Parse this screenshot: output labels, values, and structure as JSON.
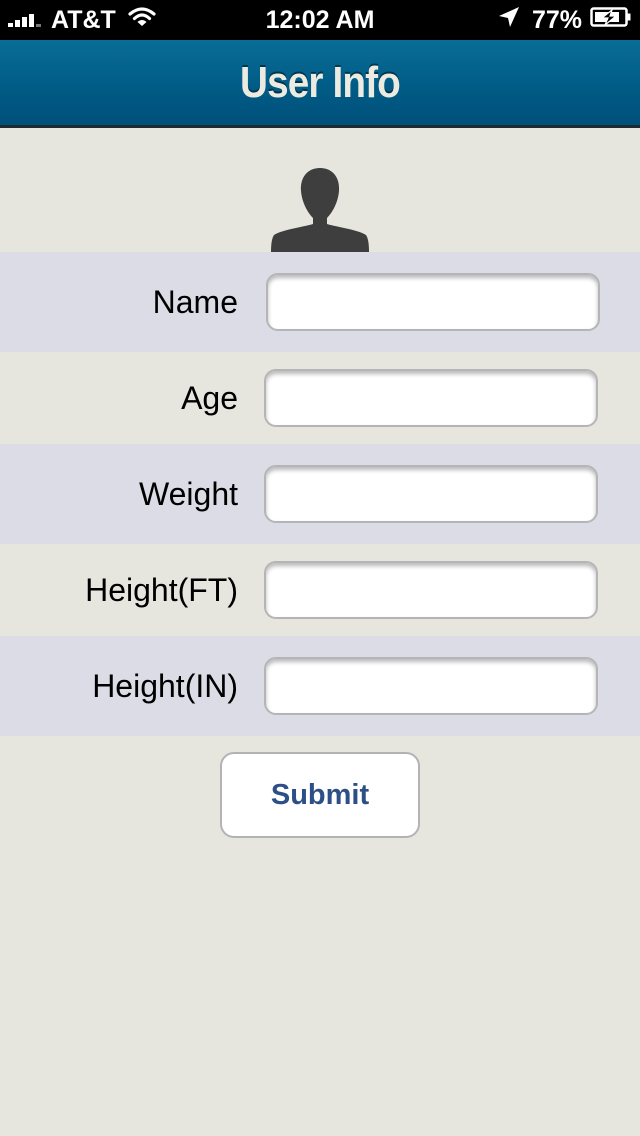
{
  "status_bar": {
    "carrier": "AT&T",
    "time": "12:02 AM",
    "battery": "77%",
    "icons": [
      "signal-icon",
      "wifi-icon",
      "location-icon",
      "battery-charging-icon"
    ]
  },
  "nav": {
    "title": "User Info"
  },
  "avatar": {
    "icon": "user-silhouette-icon"
  },
  "form": {
    "fields": [
      {
        "label": "Name",
        "value": "",
        "placeholder": ""
      },
      {
        "label": "Age",
        "value": "",
        "placeholder": ""
      },
      {
        "label": "Weight",
        "value": "",
        "placeholder": ""
      },
      {
        "label": "Height(FT)",
        "value": "",
        "placeholder": ""
      },
      {
        "label": "Height(IN)",
        "value": "",
        "placeholder": ""
      }
    ],
    "submit_label": "Submit"
  },
  "colors": {
    "nav_background": "#005c86",
    "nav_title": "#ecebe2",
    "page_background": "#e6e5de",
    "shaded_row": "#dcdce6",
    "submit_text": "#2e4f86",
    "avatar": "#3e3e3e"
  }
}
